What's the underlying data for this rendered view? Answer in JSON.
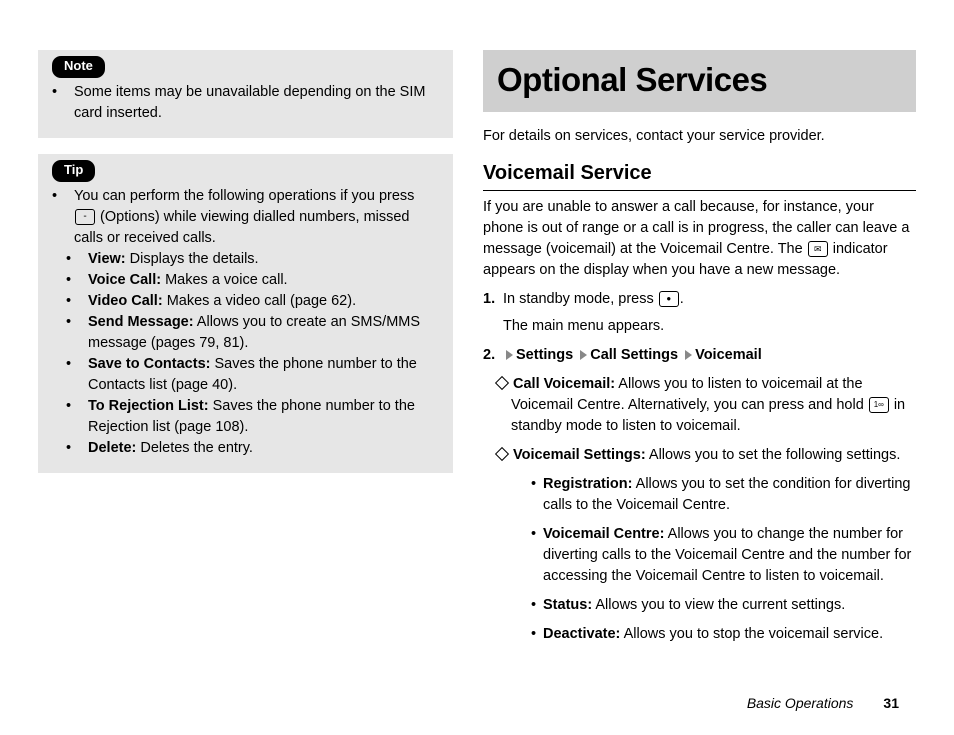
{
  "left": {
    "note_label": "Note",
    "note_item": "Some items may be unavailable depending on the SIM card inserted.",
    "tip_label": "Tip",
    "tip_intro": "You can perform the following operations if you press ",
    "tip_intro2": " (Options) while viewing dialled numbers, missed calls or received calls.",
    "ops": {
      "view_l": "View:",
      "view_t": " Displays the details.",
      "voice_l": "Voice Call:",
      "voice_t": " Makes a voice call.",
      "video_l": "Video Call:",
      "video_t": " Makes a video call (page 62).",
      "send_l": "Send Message:",
      "send_t": " Allows you to create an SMS/MMS message (pages 79, 81).",
      "save_l": "Save to Contacts:",
      "save_t": " Saves the phone number to the Contacts list (page 40).",
      "rej_l": "To Rejection List:",
      "rej_t": " Saves the phone number to the Rejection list (page 108).",
      "del_l": "Delete:",
      "del_t": " Deletes the entry."
    }
  },
  "right": {
    "banner": "Optional Services",
    "intro": "For details on services, contact your service provider.",
    "h2": "Voicemail Service",
    "p1a": "If you are unable to answer a call because, for instance, your phone is out of range or a call is in progress, the caller can leave a message (voicemail) at the Voicemail Centre. The ",
    "p1b": " indicator appears on the display when you have a new message.",
    "s1n": "1.",
    "s1a": "In standby mode, press ",
    "s1b": ".",
    "s1c": "The main menu appears.",
    "s2n": "2.",
    "s2_settings": "Settings",
    "s2_call": "Call Settings",
    "s2_vm": "Voicemail",
    "cv_l": "Call Voicemail:",
    "cv_t1": " Allows you to listen to voicemail at the Voicemail Centre. Alternatively, you can press and hold ",
    "cv_t2": " in standby mode to listen to voicemail.",
    "vs_l": "Voicemail Settings:",
    "vs_t": " Allows you to set the following settings.",
    "reg_l": "Registration:",
    "reg_t": " Allows you to set the condition for diverting calls to the Voicemail Centre.",
    "vc_l": "Voicemail Centre:",
    "vc_t": " Allows you to change the number for diverting calls to the Voicemail Centre and the number for accessing the Voicemail Centre to listen to voicemail.",
    "st_l": "Status:",
    "st_t": " Allows you to view the current settings.",
    "de_l": "Deactivate:",
    "de_t": " Allows you to stop the voicemail service."
  },
  "footer": {
    "section": "Basic Operations",
    "page": "31"
  }
}
